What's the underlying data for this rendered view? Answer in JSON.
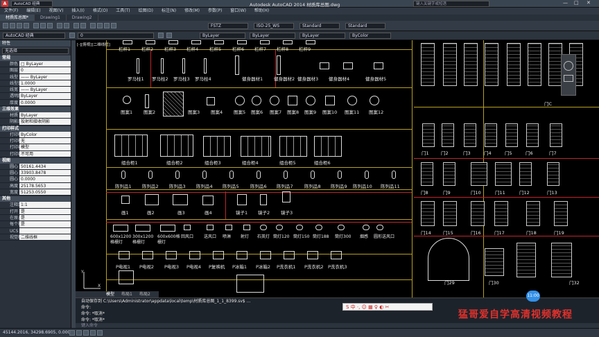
{
  "titlebar": {
    "app_combo": "AutoCAD 经典",
    "title": "Autodesk AutoCAD 2014    材质库总图.dwg",
    "search_placeholder": "键入关键字或短语",
    "min": "—",
    "max": "□",
    "close": "✕"
  },
  "menu": [
    "文件(F)",
    "编辑(E)",
    "视图(V)",
    "插入(I)",
    "格式(O)",
    "工具(T)",
    "绘图(D)",
    "标注(N)",
    "修改(M)",
    "参数(P)",
    "窗口(W)",
    "帮助(H)"
  ],
  "doc_tabs": [
    "材质库总图*",
    "Drawing1",
    "Drawing2"
  ],
  "toolbar": {
    "workspace": "AutoCAD 经典",
    "layer": "0",
    "text_style": "FSTZ",
    "dim_style": "ISO-25_WS",
    "table_style": "Standard",
    "ml_style": "Standard",
    "color": "ByLayer",
    "linetype": "ByLayer",
    "lineweight": "ByLayer",
    "plotstyle": "ByColor"
  },
  "props": {
    "header": "特性",
    "selection": "无选择",
    "sections": [
      {
        "title": "常规",
        "rows": [
          [
            "颜色",
            "□ ByLayer"
          ],
          [
            "图层",
            "0"
          ],
          [
            "线型",
            "—— ByLayer"
          ],
          [
            "线型比例",
            "1.0000"
          ],
          [
            "线宽",
            "—— ByLayer"
          ],
          [
            "透明度",
            "ByLayer"
          ],
          [
            "厚度",
            "0.0000"
          ]
        ]
      },
      {
        "title": "三维效果",
        "rows": [
          [
            "材质",
            "ByLayer"
          ],
          [
            "阴影显示",
            "投射和接收阴影"
          ]
        ]
      },
      {
        "title": "打印样式",
        "rows": [
          [
            "打印样式",
            "ByColor"
          ],
          [
            "打印样式表",
            "无"
          ],
          [
            "打印表附着到",
            "模型"
          ],
          [
            "打印表类型",
            "不可用"
          ]
        ]
      },
      {
        "title": "视图",
        "rows": [
          [
            "圆心 X 坐标",
            "50161.4434"
          ],
          [
            "圆心 Y 坐标",
            "33903.8478"
          ],
          [
            "圆心 Z 坐标",
            "0.0000"
          ],
          [
            "高度",
            "25178.5653"
          ],
          [
            "宽度",
            "51253.0550"
          ]
        ]
      },
      {
        "title": "其他",
        "rows": [
          [
            "注释比例",
            "1:1"
          ],
          [
            "打开 UCS 图标",
            "是"
          ],
          [
            "在原点显示 UCS",
            "是"
          ],
          [
            "每个视口都显示",
            "是"
          ],
          [
            "UCS 名称",
            ""
          ],
          [
            "视觉样式",
            "二维线框"
          ]
        ]
      }
    ]
  },
  "viewport_label": "[-][俯视][二维线框]",
  "labels": {
    "row1": [
      "栏杆1",
      "栏杆2",
      "栏杆3",
      "栏杆4",
      "栏杆5",
      "栏杆6",
      "栏杆7",
      "栏杆8",
      "栏杆9"
    ],
    "row2": [
      "罗马柱1",
      "罗马柱2",
      "罗马柱3",
      "罗马柱4",
      "健身器材1",
      "健身器材2",
      "健身器材3",
      "健身器材4",
      "健身器材5"
    ],
    "row3": [
      "图案1",
      "图案2",
      "图案3",
      "图案4",
      "图案5",
      "图案6",
      "图案7",
      "图案8",
      "图案9",
      "图案10",
      "图案11",
      "图案12"
    ],
    "row4": [
      "组合柜1",
      "组合柜2",
      "组合柜3",
      "组合柜4",
      "组合柜5",
      "组合柜6"
    ],
    "row5": [
      "陈列品1",
      "陈列品2",
      "陈列品3",
      "陈列品4",
      "陈列品5",
      "陈列品6",
      "陈列品7",
      "陈列品8",
      "陈列品9",
      "陈列品10",
      "陈列品11"
    ],
    "row6": [
      "画1",
      "画2",
      "画3",
      "画4",
      "镜子1",
      "镜子2",
      "镜子3"
    ],
    "row7": [
      "600x1200格栅灯",
      "300x1200格栅灯",
      "600x600格栅灯",
      "回风口",
      "送风口",
      "喷淋",
      "射灯",
      "石英灯",
      "筒灯120",
      "筒灯150",
      "筒灯188",
      "筒灯300",
      "烟感",
      "圆形送风口"
    ],
    "row8": [
      "P电视1",
      "P电视2",
      "P电视3",
      "P电视4",
      "P复映机",
      "P冰箱1",
      "P冰箱2",
      "P洗衣机1",
      "P洗衣机2",
      "P洗衣机3"
    ],
    "doors": [
      "门1",
      "门2",
      "门3",
      "门4",
      "门5",
      "门6",
      "门7",
      "门8",
      "门9",
      "门10",
      "门11",
      "门12",
      "门13",
      "门14",
      "门15",
      "门16",
      "门17",
      "门18",
      "门19",
      "门20",
      "门21",
      "门22",
      "门23",
      "门24",
      "门25",
      "门26",
      "门27",
      "门28",
      "门29",
      "门30",
      "门31",
      "门32",
      "门C"
    ]
  },
  "layout_tabs": [
    "模型",
    "布局1",
    "布局2"
  ],
  "cmd_lines": [
    "自动保存到 C:\\Users\\Administrator\\appdata\\local\\temp\\材质库总图_1_1_8399.sv$ ...",
    "命令:",
    "命令: *取消*",
    "命令: *取消*"
  ],
  "cmd_prompt": "键入命令",
  "status_coords": "45144.2016, 34298.6905, 0.0000",
  "badge": "11:00",
  "ime": "S 中 ·, ☺ ▦ ♀ ◐ ✂",
  "watermark": "猛哥爱自学高清视频教程",
  "colors": {
    "accent": "#3390e8",
    "watermark": "#e0312c",
    "grid_red": "#c0262a",
    "grid_yellow": "#b8a020"
  }
}
